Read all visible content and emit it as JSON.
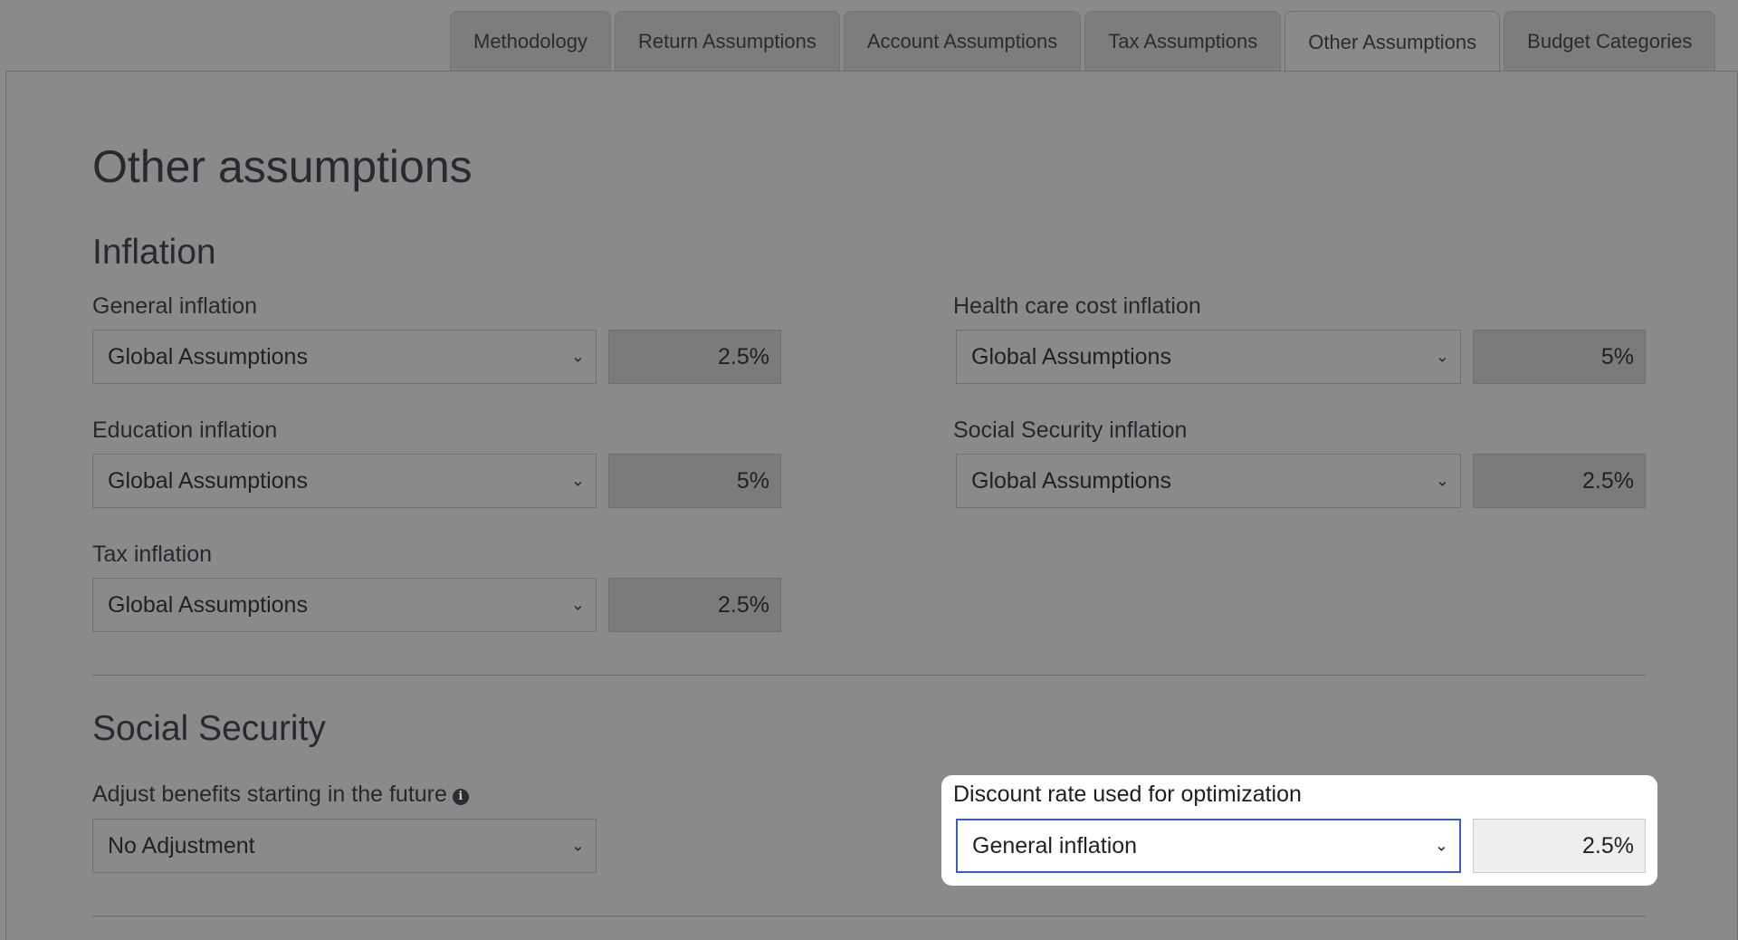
{
  "tabs": [
    {
      "label": "Methodology"
    },
    {
      "label": "Return Assumptions"
    },
    {
      "label": "Account Assumptions"
    },
    {
      "label": "Tax Assumptions"
    },
    {
      "label": "Other Assumptions",
      "active": true
    },
    {
      "label": "Budget Categories"
    }
  ],
  "page_title": "Other assumptions",
  "inflation": {
    "title": "Inflation",
    "general": {
      "label": "General inflation",
      "select": "Global Assumptions",
      "value": "2.5%"
    },
    "health": {
      "label": "Health care cost inflation",
      "select": "Global Assumptions",
      "value": "5%"
    },
    "education": {
      "label": "Education inflation",
      "select": "Global Assumptions",
      "value": "5%"
    },
    "social_security": {
      "label": "Social Security inflation",
      "select": "Global Assumptions",
      "value": "2.5%"
    },
    "tax": {
      "label": "Tax inflation",
      "select": "Global Assumptions",
      "value": "2.5%"
    }
  },
  "social_security": {
    "title": "Social Security",
    "adjust": {
      "label": "Adjust benefits starting in the future",
      "select": "No Adjustment",
      "info_icon": "info-icon"
    },
    "discount": {
      "label": "Discount rate used for optimization",
      "select": "General inflation",
      "value": "2.5%"
    }
  },
  "colors": {
    "background": "#8a8a8a",
    "highlight": "#ffffff",
    "focus_border": "#3a5bd0"
  }
}
